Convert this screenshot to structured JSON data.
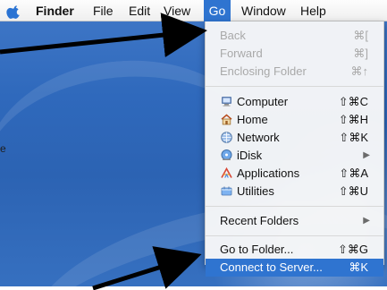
{
  "menubar": {
    "apple_icon": "apple-icon",
    "items": [
      "Finder",
      "File",
      "Edit",
      "View",
      "Go",
      "Window",
      "Help"
    ]
  },
  "go_menu": {
    "groups": [
      [
        {
          "label": "Back",
          "shortcut": "⌘[",
          "disabled": true
        },
        {
          "label": "Forward",
          "shortcut": "⌘]",
          "disabled": true
        },
        {
          "label": "Enclosing Folder",
          "shortcut": "⌘↑",
          "disabled": true
        }
      ],
      [
        {
          "label": "Computer",
          "shortcut": "⇧⌘C",
          "icon": "computer-icon"
        },
        {
          "label": "Home",
          "shortcut": "⇧⌘H",
          "icon": "home-icon"
        },
        {
          "label": "Network",
          "shortcut": "⇧⌘K",
          "icon": "network-icon"
        },
        {
          "label": "iDisk",
          "submenu_arrow": "▶",
          "icon": "idisk-icon"
        },
        {
          "label": "Applications",
          "shortcut": "⇧⌘A",
          "icon": "applications-icon"
        },
        {
          "label": "Utilities",
          "shortcut": "⇧⌘U",
          "icon": "utilities-icon"
        }
      ],
      [
        {
          "label": "Recent Folders",
          "submenu_arrow": "▶"
        }
      ],
      [
        {
          "label": "Go to Folder...",
          "shortcut": "⇧⌘G"
        },
        {
          "label": "Connect to Server...",
          "shortcut": "⌘K",
          "highlighted": true
        }
      ]
    ]
  },
  "desktop": {
    "left_edge_text": "e"
  },
  "colors": {
    "menu_highlight": "#2f74d0",
    "desktop_blue": "#2f69bc",
    "arrow_black": "#000000"
  }
}
